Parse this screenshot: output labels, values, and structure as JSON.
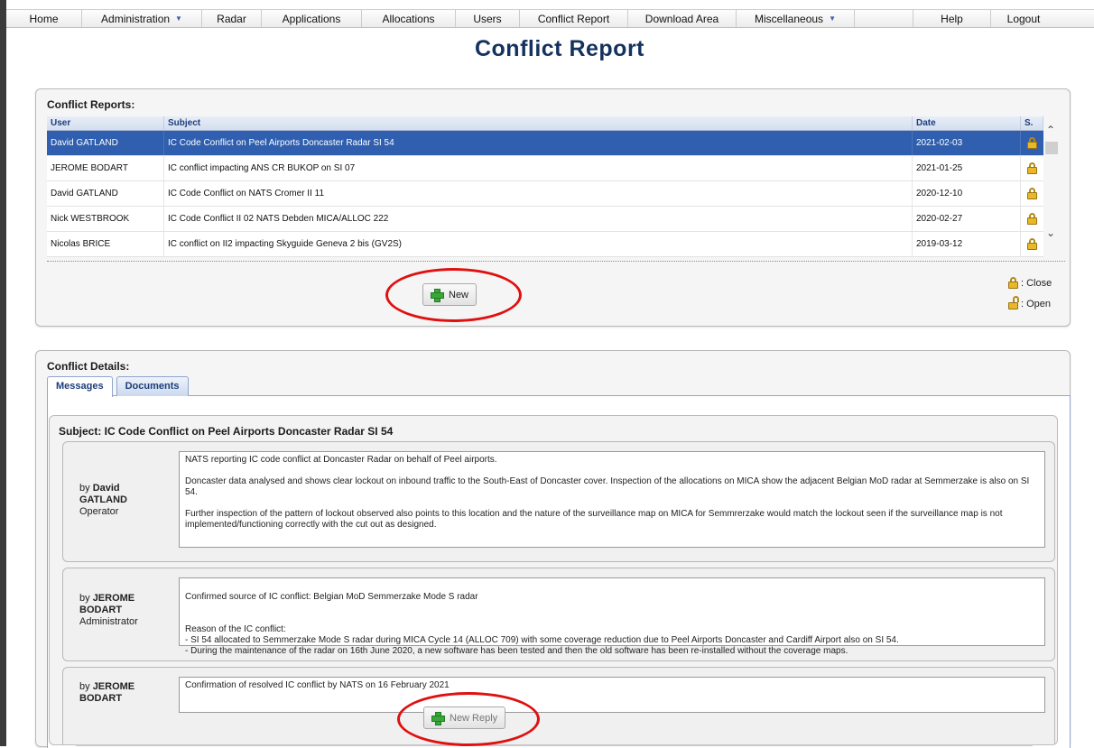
{
  "nav": {
    "items": [
      {
        "label": "Home",
        "caret": false
      },
      {
        "label": "Administration",
        "caret": true
      },
      {
        "label": "Radar",
        "caret": false
      },
      {
        "label": "Applications",
        "caret": false
      },
      {
        "label": "Allocations",
        "caret": false
      },
      {
        "label": "Users",
        "caret": false
      },
      {
        "label": "Conflict Report",
        "caret": false
      },
      {
        "label": "Download Area",
        "caret": false
      },
      {
        "label": "Miscellaneous",
        "caret": true
      }
    ],
    "help": "Help",
    "logout": "Logout",
    "caret_glyph": "▼"
  },
  "page_title": "Conflict Report",
  "reports": {
    "title": "Conflict Reports:",
    "columns": {
      "user": "User",
      "subject": "Subject",
      "date": "Date",
      "status": "S."
    },
    "rows": [
      {
        "user": "David GATLAND",
        "subject": "IC Code Conflict on Peel Airports Doncaster Radar SI 54",
        "date": "2021-02-03",
        "status": "closed",
        "selected": true
      },
      {
        "user": "JEROME BODART",
        "subject": "IC conflict impacting ANS CR BUKOP on SI 07",
        "date": "2021-01-25",
        "status": "closed",
        "selected": false
      },
      {
        "user": "David GATLAND",
        "subject": "IC Code Conflict on NATS Cromer II 11",
        "date": "2020-12-10",
        "status": "closed",
        "selected": false
      },
      {
        "user": "Nick WESTBROOK",
        "subject": "IC Code Conflict II 02 NATS Debden MICA/ALLOC 222",
        "date": "2020-02-27",
        "status": "closed",
        "selected": false
      },
      {
        "user": "Nicolas BRICE",
        "subject": "IC conflict on II2 impacting Skyguide Geneva 2 bis (GV2S)",
        "date": "2019-03-12",
        "status": "closed",
        "selected": false
      }
    ],
    "new_button": "New",
    "legend_close": ": Close",
    "legend_open": ": Open"
  },
  "details": {
    "title": "Conflict Details:",
    "tabs": [
      "Messages",
      "Documents"
    ],
    "subject": "Subject: IC Code Conflict on Peel Airports Doncaster Radar SI 54",
    "messages": [
      {
        "by": "by",
        "author": "David GATLAND",
        "role": "Operator",
        "paragraphs": [
          "NATS reporting IC code conflict at Doncaster Radar on behalf of Peel airports.",
          "Doncaster data analysed and shows clear lockout on inbound traffic to the South-East of Doncaster cover. Inspection of the allocations on MICA show the adjacent Belgian MoD radar at Semmerzake is also on SI 54.",
          "Further inspection of the pattern of lockout observed also points to this location and the nature of the surveillance map on MICA for Semmrerzake would match the lockout seen if the surveillance map is not implemented/functioning correctly with the cut out as designed."
        ]
      },
      {
        "by": "by",
        "author": "JEROME BODART",
        "role": "Administrator",
        "paragraphs": [
          "Confirmed source of IC conflict: Belgian MoD Semmerzake Mode S radar",
          "Reason of the IC conflict:\n- SI 54 allocated to Semmerzake Mode S radar during MICA Cycle 14 (ALLOC 709) with some coverage reduction due to Peel Airports Doncaster and Cardiff Airport also on SI 54.\n- During the maintenance of the radar on 16th June 2020, a new software has been tested and then the old software has been re-installed without the coverage maps."
        ]
      },
      {
        "by": "by",
        "author": "JEROME BODART",
        "role": "",
        "paragraphs": [
          "Confirmation of resolved IC conflict by NATS on 16 February 2021"
        ]
      }
    ],
    "new_reply_button": "New Reply"
  },
  "colors": {
    "title": "#14325e",
    "selected_row": "#2f5fae",
    "annotation_red": "#e01010",
    "lock_gold": "#e8b828"
  }
}
